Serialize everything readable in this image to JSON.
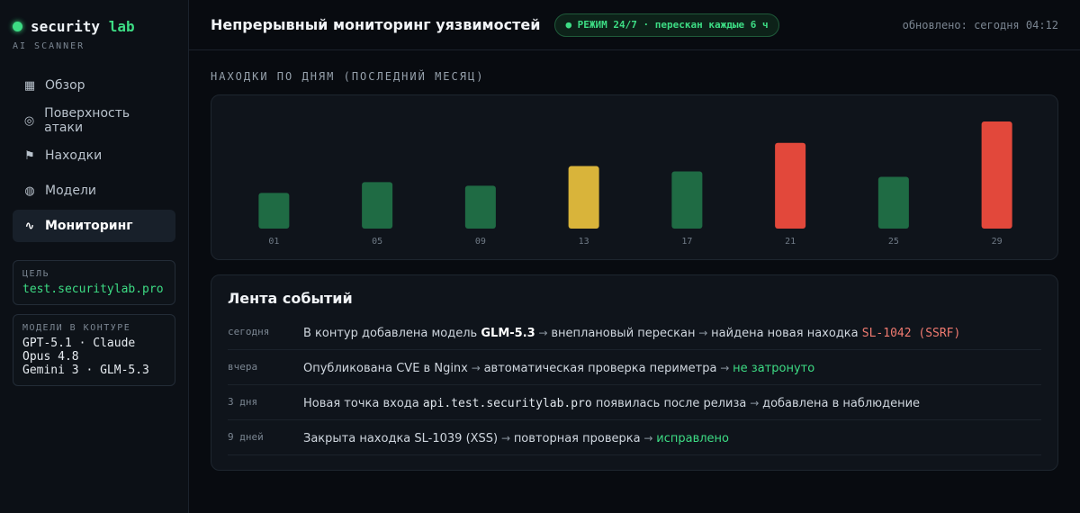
{
  "brand": {
    "name": "security",
    "accent": "lab",
    "subtitle": "AI SCANNER"
  },
  "nav": [
    {
      "label": "Обзор",
      "icon": "grid-icon",
      "glyph": "▦"
    },
    {
      "label": "Поверхность атаки",
      "icon": "target-icon",
      "glyph": "◎"
    },
    {
      "label": "Находки",
      "icon": "flag-icon",
      "glyph": "⚑"
    },
    {
      "label": "Модели",
      "icon": "globe-icon",
      "glyph": "◍"
    },
    {
      "label": "Мониторинг",
      "icon": "pulse-icon",
      "glyph": "∿",
      "active": true
    }
  ],
  "target": {
    "label": "ЦЕЛЬ",
    "value": "test.securitylab.pro"
  },
  "models": {
    "label": "МОДЕЛИ В КОНТУРЕ",
    "line1": "GPT-5.1 · Claude Opus 4.8",
    "line2": "Gemini 3 · GLM-5.3"
  },
  "header": {
    "title": "Непрерывный мониторинг уязвимостей",
    "badge": "● РЕЖИМ 24/7 · перескан каждые 6 ч",
    "updated": "обновлено: сегодня 04:12"
  },
  "section_title": "НАХОДКИ ПО ДНЯМ (ПОСЛЕДНИЙ МЕСЯЦ)",
  "chart_data": {
    "type": "bar",
    "categories": [
      "01",
      "05",
      "09",
      "13",
      "17",
      "21",
      "25",
      "29"
    ],
    "values": [
      4,
      5.2,
      4.8,
      7,
      6.4,
      9.6,
      5.8,
      12
    ],
    "levels": [
      "low",
      "low",
      "low",
      "medium",
      "low",
      "high",
      "low",
      "high"
    ],
    "ylim": [
      0,
      12.5
    ],
    "grid": false,
    "colors": {
      "low": "#1f6b44",
      "medium": "#d9b43a",
      "high": "#e2483b"
    }
  },
  "feed": {
    "title": "Лента событий",
    "items": [
      {
        "time": "сегодня",
        "t1": "В контур добавлена модель ",
        "b": "GLM-5.3",
        "a1": " → ",
        "t2": "внеплановый перескан",
        "a2": " → ",
        "t3": "найдена новая находка ",
        "hl": "SL-1042 (SSRF)"
      },
      {
        "time": "вчера",
        "t1": "Опубликована CVE в Nginx",
        "a1": " → ",
        "t2": "автоматическая проверка периметра",
        "a2": " → ",
        "hl": "не затронуто"
      },
      {
        "time": "3 дня",
        "t1": "Новая точка входа ",
        "code": "api.test.securitylab.pro",
        "t2": " появилась после релиза",
        "a1": " → ",
        "t3": "добавлена в наблюдение"
      },
      {
        "time": "9 дней",
        "t1": "Закрыта находка SL-1039 (XSS)",
        "a1": " → ",
        "t2": "повторная проверка",
        "a2": " → ",
        "hl": "исправлено"
      }
    ]
  }
}
